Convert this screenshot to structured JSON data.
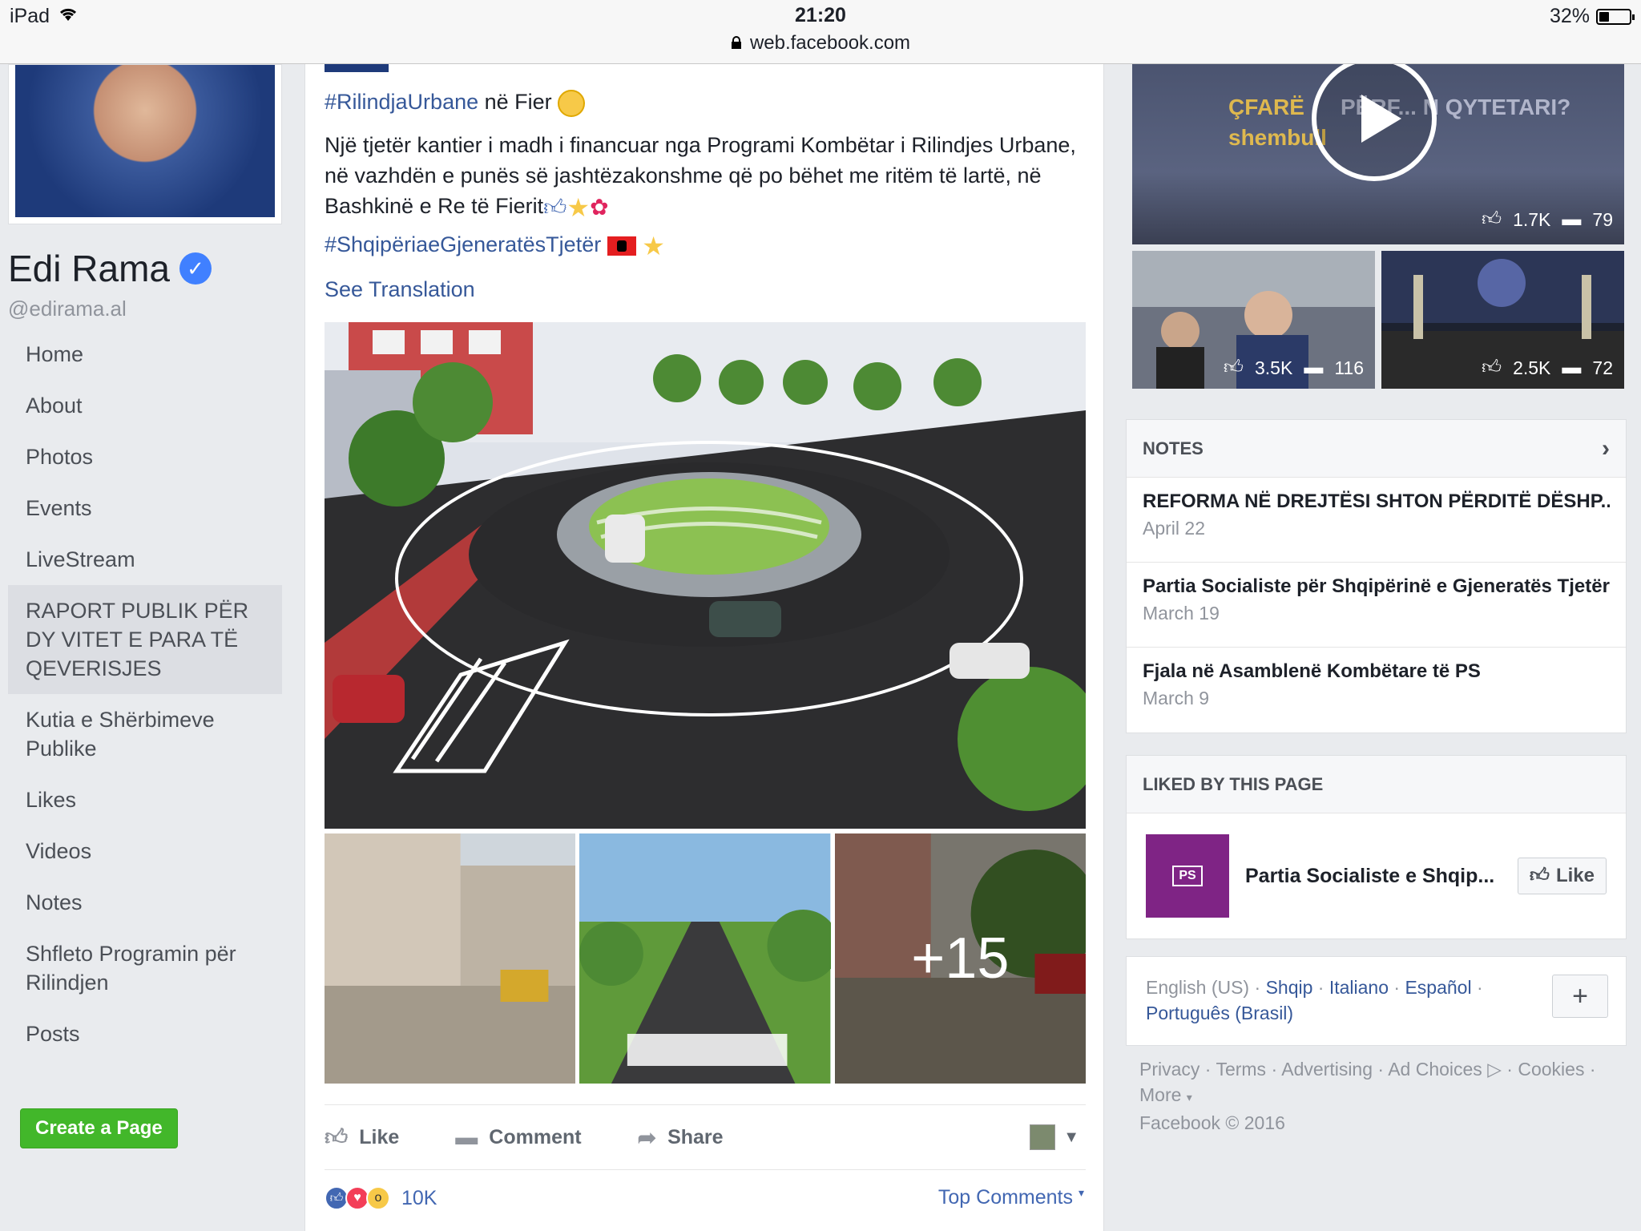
{
  "status": {
    "device": "iPad",
    "time": "21:20",
    "url": "web.facebook.com",
    "battery": "32%",
    "battery_level": 0.32
  },
  "profile": {
    "name": "Edi Rama",
    "handle": "@edirama.al"
  },
  "nav": [
    "Home",
    "About",
    "Photos",
    "Events",
    "LiveStream",
    "RAPORT PUBLIK PËR DY VITET E PARA TË QEVERISJES",
    "Kutia e Shërbimeve Publike",
    "Likes",
    "Videos",
    "Notes",
    "Shfleto Programin për Rilindjen",
    "Posts"
  ],
  "create_page": "Create a Page",
  "post": {
    "hashtag1": "#RilindjaUrbane",
    "line1_rest": " në Fier",
    "body": "Një tjetër kantier i madh i financuar nga Programi Kombëtar i Rilindjes Urbane, në vazhdën e punës së jashtëzakonshme që po bëhet me ritëm të lartë, në Bashkinë e Re të Fierit",
    "hashtag2": "#ShqipëriaeGjeneratësTjetër",
    "see_translation": "See Translation",
    "more_photos": "+15",
    "actions": {
      "like": "Like",
      "comment": "Comment",
      "share": "Share"
    },
    "reaction_count": "10K",
    "top_comments": "Top Comments"
  },
  "videos": {
    "top": {
      "title_a": "ÇFARË",
      "title_b": "PËRF... N QYTETARI?",
      "title_c": "shembull",
      "likes": "1.7K",
      "comments": "79"
    },
    "left": {
      "likes": "3.5K",
      "comments": "116"
    },
    "right": {
      "likes": "2.5K",
      "comments": "72"
    }
  },
  "notes": {
    "header": "NOTES",
    "items": [
      {
        "title": "REFORMA NË DREJTËSI SHTON PËRDITË DËSHP...",
        "date": "April 22"
      },
      {
        "title": "Partia Socialiste për Shqipërinë e Gjeneratës Tjetër",
        "date": "March 19"
      },
      {
        "title": "Fjala në Asamblenë Kombëtare të PS",
        "date": "March 9"
      }
    ]
  },
  "liked": {
    "header": "LIKED BY THIS PAGE",
    "logo_text": "PS",
    "name": "Partia Socialiste e Shqip...",
    "button": "Like"
  },
  "languages": {
    "current": "English (US)",
    "l1": "Shqip",
    "l2": "Italiano",
    "l3": "Español",
    "l4": "Português (Brasil)",
    "plus": "+"
  },
  "footer": {
    "privacy": "Privacy",
    "terms": "Terms",
    "advertising": "Advertising",
    "adchoices": "Ad Choices",
    "cookies": "Cookies",
    "more": "More",
    "copyright": "Facebook © 2016"
  }
}
